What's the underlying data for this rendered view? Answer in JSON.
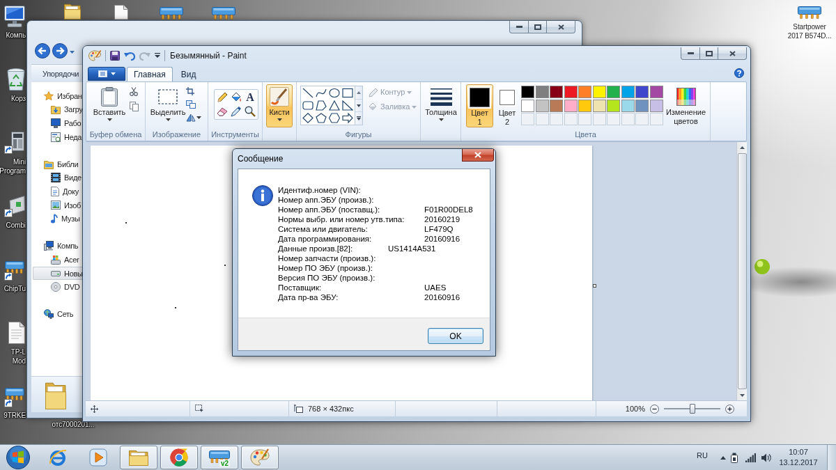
{
  "desktop": {
    "left_icons": [
      {
        "lines": [
          "Компь"
        ]
      },
      {
        "lines": [
          "Корз"
        ]
      },
      {
        "lines": [
          "Mini",
          "Program"
        ]
      },
      {
        "lines": [
          "Combi"
        ]
      },
      {
        "lines": [
          "ChipTu"
        ]
      },
      {
        "lines": [
          "TP-L",
          "Mod"
        ]
      },
      {
        "lines": [
          "9TRKE"
        ]
      }
    ],
    "right_icon": {
      "lines": [
        "Startpower",
        "2017 B574D..."
      ]
    },
    "bottom_icon": {
      "lines": [
        "отс7000201..."
      ]
    }
  },
  "explorer": {
    "organize": "Упорядочи",
    "nav": [
      {
        "label": "Избран",
        "selected": false,
        "children": [
          {
            "label": "Загру",
            "selected": false
          },
          {
            "label": "Рабо",
            "selected": false
          },
          {
            "label": "Неда",
            "selected": false
          }
        ]
      },
      {
        "label": "Библи",
        "selected": false,
        "children": [
          {
            "label": "Виде",
            "selected": false
          },
          {
            "label": "Доку",
            "selected": false
          },
          {
            "label": "Изоб",
            "selected": false
          },
          {
            "label": "Музы",
            "selected": false
          }
        ]
      },
      {
        "label": "Компь",
        "selected": false,
        "children": [
          {
            "label": "Acer",
            "selected": false
          },
          {
            "label": "Новы",
            "selected": true
          },
          {
            "label": "DVD",
            "selected": false
          }
        ]
      },
      {
        "label": "Сеть",
        "selected": false
      }
    ]
  },
  "paint": {
    "title": "Безымянный - Paint",
    "tabs": [
      {
        "label": "Главная",
        "selected": true
      },
      {
        "label": "Вид",
        "selected": false
      }
    ],
    "ribbon": {
      "clipboard": {
        "label": "Буфер обмена",
        "paste": "Вставить"
      },
      "image": {
        "label": "Изображение",
        "select": "Выделить"
      },
      "tools": {
        "label": "Инструменты",
        "text_tool": "A"
      },
      "brushes": {
        "label": "Кисти",
        "selected": true
      },
      "shapes": {
        "label": "Фигуры",
        "outline": {
          "label": "Контур",
          "disabled": true
        },
        "fill": {
          "label": "Заливка",
          "disabled": true
        }
      },
      "size": {
        "label": "Толщина"
      },
      "colors": {
        "label": "Цвета",
        "color_1": {
          "label": "Цвет 1",
          "selected": true,
          "color": "#000000"
        },
        "color_2": {
          "label": "Цвет 2",
          "selected": false,
          "color": "#ffffff"
        },
        "palette": [
          {
            "color": "#000000"
          },
          {
            "color": "#7f7f7f"
          },
          {
            "color": "#880015"
          },
          {
            "color": "#ed1c24"
          },
          {
            "color": "#ff7f27"
          },
          {
            "color": "#fff200"
          },
          {
            "color": "#22b14c"
          },
          {
            "color": "#00a2e8"
          },
          {
            "color": "#3f48cc"
          },
          {
            "color": "#a349a4"
          },
          {
            "color": "#ffffff"
          },
          {
            "color": "#c3c3c3"
          },
          {
            "color": "#b97a57"
          },
          {
            "color": "#ffaec9"
          },
          {
            "color": "#ffc90e"
          },
          {
            "color": "#efe4b0"
          },
          {
            "color": "#b5e61d"
          },
          {
            "color": "#99d9ea"
          },
          {
            "color": "#7092be"
          },
          {
            "color": "#c8bfe7"
          }
        ],
        "edit": "Изменение цветов"
      }
    },
    "status_bar": {
      "size": "768 × 432пкс",
      "zoom": "100%",
      "zoom_slider": {
        "level": 0.5
      }
    }
  },
  "dialog": {
    "title": "Сообщение",
    "rows": [
      {
        "label": "Идентиф.номер (VIN):"
      },
      {
        "label": "Номер апп.ЭБУ (произв.):"
      },
      {
        "label": "Номер апп.ЭБУ (поставщ.):",
        "value": "F01R00DEL8",
        "kind": "far"
      },
      {
        "label": "Нормы выбр. или номер утв.типа:",
        "value": "20160219",
        "kind": "far"
      },
      {
        "label": "Система или двигатель:",
        "value": "LF479Q",
        "kind": "far"
      },
      {
        "label": "Дата программирования:",
        "value": "20160916",
        "kind": "far"
      },
      {
        "label": "Данные произв.[82]:",
        "value": "US1414A531",
        "kind": "near"
      },
      {
        "label": "Номер запчасти (произв.):"
      },
      {
        "label": "Номер ПО ЭБУ (произв.):"
      },
      {
        "label": "Версия ПО ЭБУ (произв.):"
      },
      {
        "label": "Поставщик:",
        "value": "UAES",
        "kind": "far"
      },
      {
        "label": "Дата пр-ва ЭБУ:",
        "value": "20160916",
        "kind": "far"
      }
    ],
    "button": "OK"
  },
  "taskbar": {
    "apps": [
      {
        "open": false
      },
      {
        "open": false
      },
      {
        "open": true
      },
      {
        "open": true
      },
      {
        "open": true,
        "badge": "v2"
      },
      {
        "open": true
      }
    ],
    "tray": {
      "language": "RU",
      "time": "10:07",
      "date": "13.12.2017"
    }
  }
}
